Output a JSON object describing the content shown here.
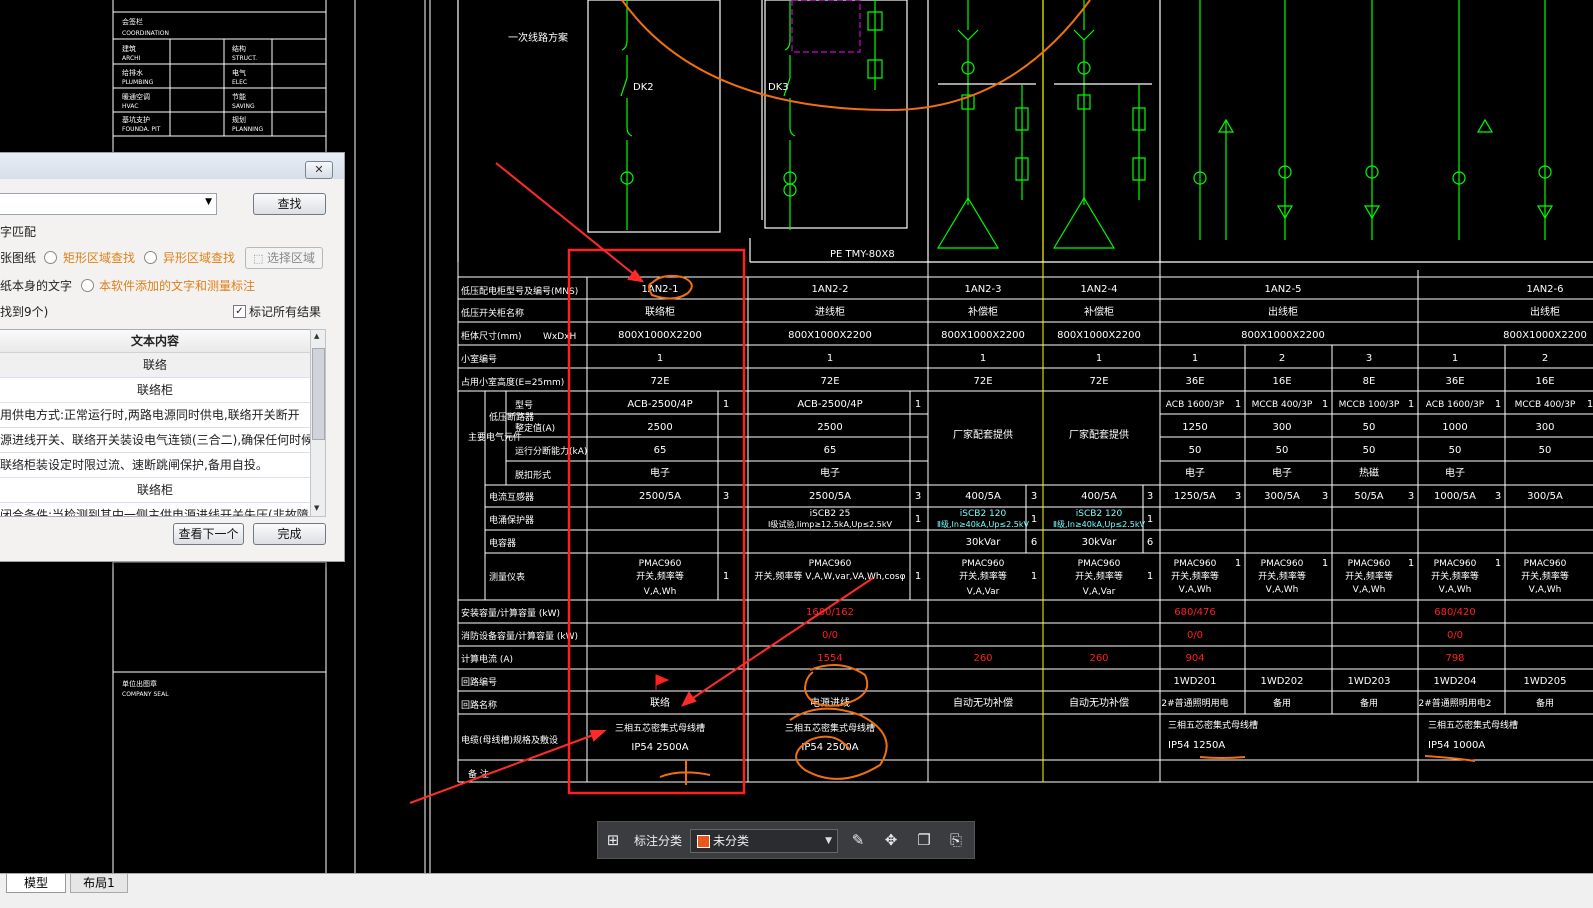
{
  "titleblock": {
    "coordination_cn": "会签栏",
    "coordination_en": "COORDINATION",
    "archi_cn": "建筑",
    "archi_en": "ARCHI",
    "struct_cn": "结构",
    "struct_en": "STRUCT.",
    "plumbing_cn": "给排水",
    "plumbing_en": "PLUMBING",
    "elec_cn": "电气",
    "elec_en": "ELEC",
    "hvac_cn": "暖通空调",
    "hvac_en": "HVAC",
    "saving_cn": "节能",
    "saving_en": "SAVING",
    "founda_cn": "基坑支护",
    "founda_en": "FOUNDA. PIT",
    "planning_cn": "规划",
    "planning_en": "PLANNING",
    "seal_cn": "单位出图章",
    "seal_en": "COMPANY SEAL"
  },
  "diagram": {
    "primary_label": "一次线路方案",
    "dk2": "DK2",
    "dk3": "DK3",
    "busbar": "PE TMY-80X8"
  },
  "schedule": {
    "row_labels": {
      "panel_no": "低压配电柜型号及编号(MNS)",
      "panel_use": "低压开关柜名称",
      "dims": "柜体尺寸(mm)",
      "dims_unit": "WxDxH",
      "drawer_no": "小室编号",
      "drawer_height": "占用小室高度(E=25mm)",
      "main_elements": "主要电气元件",
      "lv_breaker": "低压断路器",
      "model": "型号",
      "rated_current": "整定值(A)",
      "breaking": "运行分断能力(kA)",
      "trip": "脱扣形式",
      "ct": "电流互感器",
      "spd": "电涌保护器",
      "capacitor": "电容器",
      "meter": "测量仪表",
      "install_cap": "安装容量/计算容量 (kW)",
      "reserve_cap": "消防设备容量/计算容量 (kW)",
      "calc_current": "计算电流 (A)",
      "circuit_no": "回路编号",
      "circuit_name": "回路名称",
      "cable": "电缆(母线槽)规格及敷设",
      "remark": "备 注"
    },
    "columns": [
      {
        "panel_no": "1AN2-1",
        "use": "联络柜",
        "dims": "800X1000X2200",
        "drawer": "1",
        "height": "72E",
        "model": "ACB-2500/4P",
        "qty": "1",
        "rated": "2500",
        "breaking": "65",
        "trip": "电子",
        "ct": "2500/5A",
        "ct_qty": "3",
        "meter_l1": "PMAC960",
        "meter_l2": "开关,频率等",
        "meter_l3": "V,A,Wh",
        "meter_qty": "1",
        "circuit_name": "联络",
        "cable_l1": "三相五芯密集式母线槽",
        "cable_l2": "IP54   2500A"
      },
      {
        "panel_no": "1AN2-2",
        "use": "进线柜",
        "dims": "800X1000X2200",
        "drawer": "1",
        "height": "72E",
        "model": "ACB-2500/4P",
        "qty": "1",
        "rated": "2500",
        "breaking": "65",
        "trip": "电子",
        "ct": "2500/5A",
        "ct_qty": "3",
        "spd_l1": "iSCB2 25",
        "spd_l2": "Ⅰ级试验,Iimp≥12.5kA,Up≤2.5kV",
        "spd_qty": "1",
        "meter_l1": "PMAC960",
        "meter_l2": "开关,频率等 V,A,W,var,VA,Wh,cosφ",
        "meter_qty": "1",
        "install": "1680/162",
        "reserve": "0/0",
        "current": "1554",
        "circuit_name": "电源进线",
        "cable_l1": "三相五芯密集式母线槽",
        "cable_l2": "IP54   2500A"
      },
      {
        "panel_no": "1AN2-3",
        "use": "补偿柜",
        "dims": "800X1000X2200",
        "drawer": "1",
        "height": "72E",
        "breaker_note": "厂家配套提供",
        "ct": "400/5A",
        "ct_qty": "3",
        "spd_l1": "iSCB2 120",
        "spd_l2": "Ⅱ级,In≥40kA,Up≤2.5kV",
        "spd_qty": "1",
        "cap": "30kVar",
        "cap_qty": "6",
        "meter_l1": "PMAC960",
        "meter_l2": "开关,频率等",
        "meter_l3": "V,A,Var",
        "meter_qty": "1",
        "current": "260",
        "circuit_name": "自动无功补偿"
      },
      {
        "panel_no": "1AN2-4",
        "use": "补偿柜",
        "dims": "800X1000X2200",
        "drawer": "1",
        "height": "72E",
        "breaker_note": "厂家配套提供",
        "ct": "400/5A",
        "ct_qty": "3",
        "spd_l1": "iSCB2 120",
        "spd_l2": "Ⅱ级,In≥40kA,Up≤2.5kV",
        "spd_qty": "1",
        "cap": "30kVar",
        "cap_qty": "6",
        "meter_l1": "PMAC960",
        "meter_l2": "开关,频率等",
        "meter_l3": "V,A,Var",
        "meter_qty": "1",
        "current": "260",
        "circuit_name": "自动无功补偿"
      },
      {
        "panel_no": "1AN2-5",
        "use": "出线柜",
        "dims": "800X1000X2200",
        "subs": [
          {
            "drawer": "1",
            "height": "36E",
            "model": "ACB 1600/3P",
            "qty": "1",
            "rated": "1250",
            "breaking": "50",
            "trip": "电子",
            "ct": "1250/5A",
            "ct_qty": "3",
            "meter_l1": "PMAC960",
            "meter_l2": "开关,频率等",
            "meter_l3": "V,A,Wh",
            "meter_qty": "1",
            "install": "680/476",
            "reserve": "0/0",
            "current": "904",
            "circuit": "1WD201",
            "circuit_name": "2#普通照明用电",
            "cable_l1": "三相五芯密集式母线槽",
            "cable_l2": "IP54   1250A"
          },
          {
            "drawer": "2",
            "height": "16E",
            "model": "MCCB 400/3P",
            "qty": "1",
            "rated": "300",
            "breaking": "50",
            "trip": "电子",
            "ct": "300/5A",
            "ct_qty": "3",
            "meter_l1": "PMAC960",
            "meter_l2": "开关,频率等",
            "meter_l3": "V,A,Wh",
            "meter_qty": "1",
            "circuit": "1WD202",
            "circuit_name": "备用"
          },
          {
            "drawer": "3",
            "height": "8E",
            "model": "MCCB 100/3P",
            "qty": "1",
            "rated": "50",
            "breaking": "50",
            "trip": "热磁",
            "ct": "50/5A",
            "ct_qty": "3",
            "meter_l1": "PMAC960",
            "meter_l2": "开关,频率等",
            "meter_l3": "V,A,Wh",
            "meter_qty": "1",
            "circuit": "1WD203",
            "circuit_name": "备用"
          }
        ]
      },
      {
        "panel_no": "1AN2-6",
        "use": "出线柜",
        "dims": "800X1000X2200",
        "subs": [
          {
            "drawer": "1",
            "height": "36E",
            "model": "ACB 1600/3P",
            "qty": "1",
            "rated": "1000",
            "breaking": "50",
            "trip": "电子",
            "ct": "1000/5A",
            "ct_qty": "3",
            "meter_l1": "PMAC960",
            "meter_l2": "开关,频率等",
            "meter_l3": "V,A,Wh",
            "meter_qty": "1",
            "install": "680/420",
            "reserve": "0/0",
            "current": "798",
            "circuit": "1WD204",
            "circuit_name": "2#普通照明用电2",
            "cable_l1": "三相五芯密集式母线槽",
            "cable_l2": "IP54   1000A"
          },
          {
            "drawer": "2",
            "height": "16E",
            "model": "MCCB 400/3P",
            "qty": "1",
            "rated": "300",
            "breaking": "50",
            "ct": "300/5A",
            "meter_l1": "PMAC960",
            "meter_l2": "开关,频率等",
            "meter_l3": "V,A,Wh",
            "circuit": "1WD205",
            "circuit_name": "备用"
          }
        ]
      }
    ]
  },
  "dialog": {
    "close_glyph": "✕",
    "find_button": "查找",
    "opt_text_match": "字匹配",
    "opt_drawing": "张图纸",
    "opt_rect": "矩形区域查找",
    "opt_irregular": "异形区域查找",
    "opt_select_area": "选择区域",
    "opt_drawing_text": "纸本身的文字",
    "opt_added_text": "本软件添加的文字和测量标注",
    "found_count": "找到9个)",
    "mark_all": "标记所有结果",
    "mark_all_checked": "✓",
    "table_header": "文本内容",
    "rows": [
      "联络",
      "联络柜",
      "用供电方式:正常运行时,两路电源同时供电,联络开关断开",
      "源进线开关、联络开关装设电气连锁(三合二),确保任何时候",
      "联络柜装设定时限过流、速断跳闸保护,备用自投。",
      "联络柜",
      "闭合条件:当检测到其中一侧主供电源进线开关失压(非故障"
    ],
    "next_button": "查看下一个",
    "done_button": "完成"
  },
  "toolbar": {
    "category_label": "标注分类",
    "category_value": "未分类",
    "category_color": "#e8561c"
  },
  "tabs": {
    "model": "模型",
    "layout1": "布局1"
  }
}
